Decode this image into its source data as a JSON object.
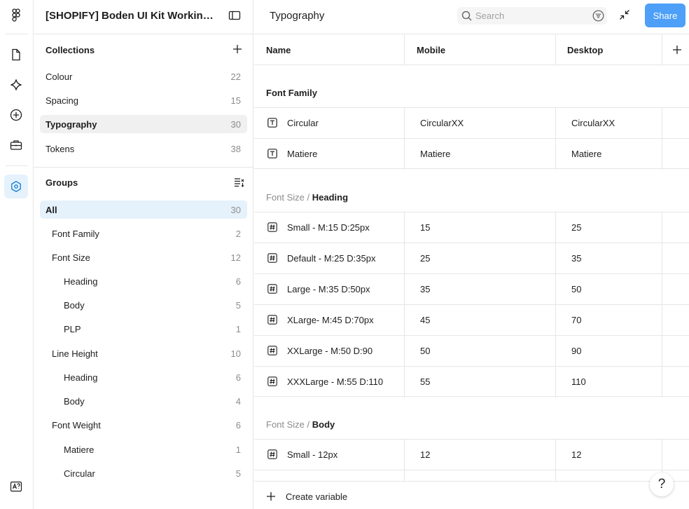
{
  "colors": {
    "accent": "#4d9ff7",
    "selected_bg": "#e5f2fc",
    "hover_bg": "#f0f0f0",
    "muted": "#8c8c8c"
  },
  "rail": {
    "icons": [
      "figma-logo-icon",
      "file-icon",
      "sparkle-icon",
      "plus-circle-icon",
      "toolbox-icon",
      "variables-hex-icon",
      "text-style-icon"
    ]
  },
  "file": {
    "title": "[SHOPIFY] Boden UI Kit Working File"
  },
  "collections": {
    "header": "Collections",
    "items": [
      {
        "label": "Colour",
        "count": "22"
      },
      {
        "label": "Spacing",
        "count": "15"
      },
      {
        "label": "Typography",
        "count": "30"
      },
      {
        "label": "Tokens",
        "count": "38"
      }
    ]
  },
  "groups": {
    "header": "Groups",
    "items": [
      {
        "label": "All",
        "count": "30"
      },
      {
        "label": "Font Family",
        "count": "2"
      },
      {
        "label": "Font Size",
        "count": "12"
      },
      {
        "label": "Heading",
        "count": "6"
      },
      {
        "label": "Body",
        "count": "5"
      },
      {
        "label": "PLP",
        "count": "1"
      },
      {
        "label": "Line Height",
        "count": "10"
      },
      {
        "label": "Heading",
        "count": "6"
      },
      {
        "label": "Body",
        "count": "4"
      },
      {
        "label": "Font Weight",
        "count": "6"
      },
      {
        "label": "Matiere",
        "count": "1"
      },
      {
        "label": "Circular",
        "count": "5"
      }
    ]
  },
  "main": {
    "title": "Typography",
    "search_placeholder": "Search",
    "share_label": "Share",
    "columns": {
      "name": "Name",
      "mobile": "Mobile",
      "desktop": "Desktop"
    },
    "sections": [
      {
        "prefix": "",
        "sep": "",
        "title": "Font Family"
      },
      {
        "prefix": "Font Size",
        "sep": " / ",
        "title": "Heading"
      },
      {
        "prefix": "Font Size",
        "sep": " / ",
        "title": "Body"
      }
    ],
    "rows": [
      {
        "name": "Circular",
        "mobile": "CircularXX",
        "desktop": "CircularXX",
        "type": "text"
      },
      {
        "name": "Matiere",
        "mobile": "Matiere",
        "desktop": "Matiere",
        "type": "text"
      },
      {
        "name": "Small - M:15 D:25px",
        "mobile": "15",
        "desktop": "25",
        "type": "number"
      },
      {
        "name": "Default - M:25 D:35px",
        "mobile": "25",
        "desktop": "35",
        "type": "number"
      },
      {
        "name": "Large - M:35 D:50px",
        "mobile": "35",
        "desktop": "50",
        "type": "number"
      },
      {
        "name": "XLarge- M:45 D:70px",
        "mobile": "45",
        "desktop": "70",
        "type": "number"
      },
      {
        "name": "XXLarge - M:50 D:90",
        "mobile": "50",
        "desktop": "90",
        "type": "number"
      },
      {
        "name": "XXXLarge - M:55 D:110",
        "mobile": "55",
        "desktop": "110",
        "type": "number"
      },
      {
        "name": "Small - 12px",
        "mobile": "12",
        "desktop": "12",
        "type": "number"
      }
    ],
    "create_label": "Create variable",
    "help_label": "?"
  }
}
